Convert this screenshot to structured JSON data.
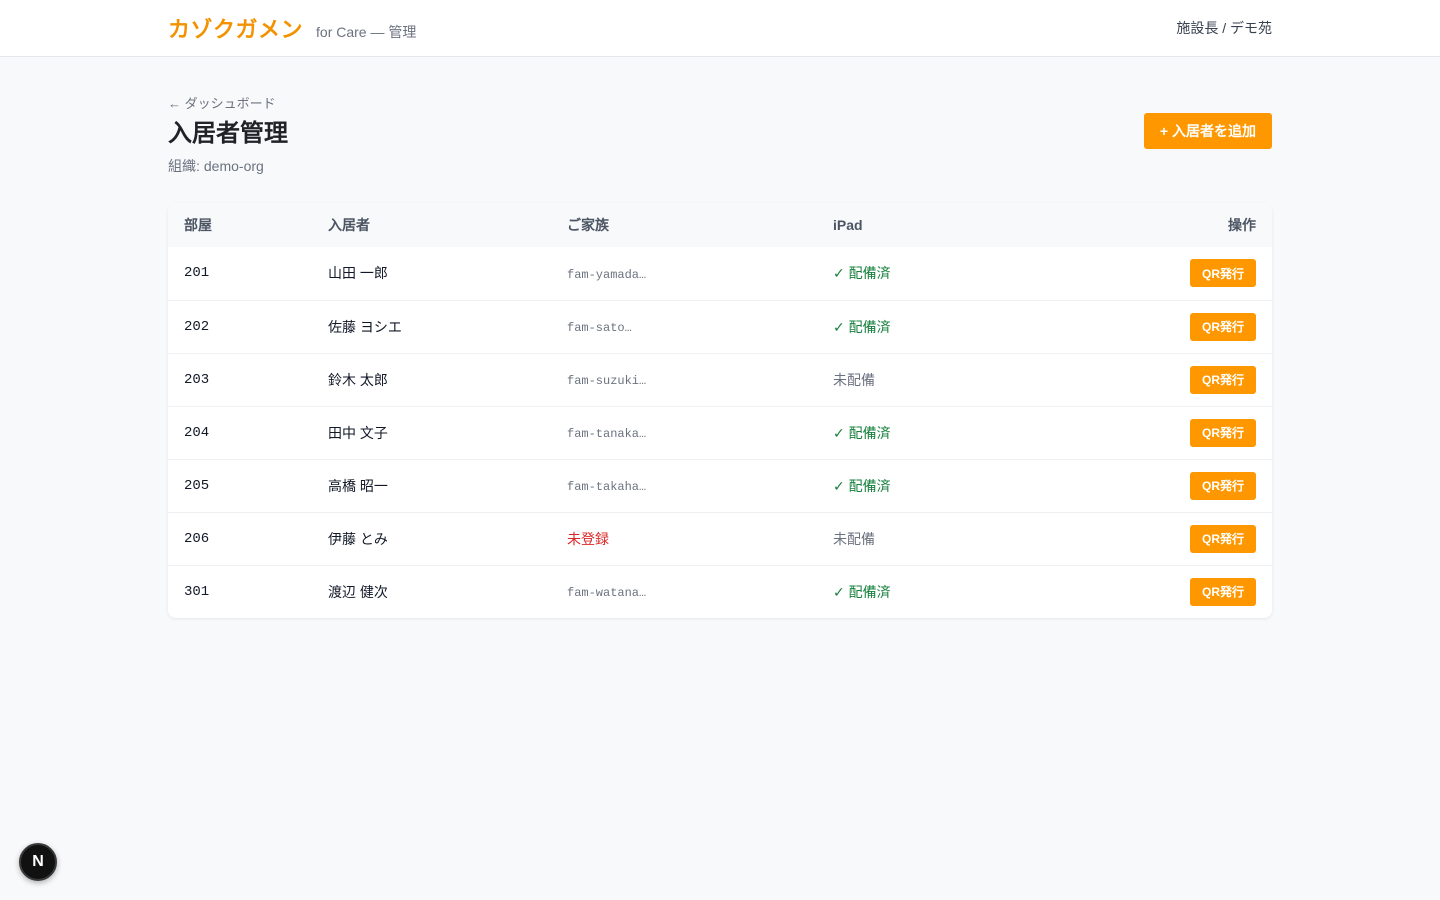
{
  "header": {
    "logo": "カゾクガメン",
    "subtitle": "for Care — 管理",
    "user": "施設長 / デモ苑"
  },
  "page": {
    "back_link": "← ダッシュボード",
    "title": "入居者管理",
    "org_label": "組織:",
    "org_value": "demo-org",
    "add_button": "+ 入居者を追加"
  },
  "table": {
    "headers": {
      "room": "部屋",
      "resident": "入居者",
      "family": "ご家族",
      "ipad": "iPad",
      "ops": "操作"
    },
    "action_label": "QR発行",
    "rows": [
      {
        "room": "201",
        "name": "山田 一郎",
        "family": "fam-yamada…",
        "ipad": "✓ 配備済"
      },
      {
        "room": "202",
        "name": "佐藤 ヨシエ",
        "family": "fam-sato…",
        "ipad": "✓ 配備済"
      },
      {
        "room": "203",
        "name": "鈴木 太郎",
        "family": "fam-suzuki…",
        "ipad": "未配備"
      },
      {
        "room": "204",
        "name": "田中 文子",
        "family": "fam-tanaka…",
        "ipad": "✓ 配備済"
      },
      {
        "room": "205",
        "name": "高橋 昭一",
        "family": "fam-takaha…",
        "ipad": "✓ 配備済"
      },
      {
        "room": "206",
        "name": "伊藤 とみ",
        "family": "未登録",
        "ipad": "未配備"
      },
      {
        "room": "301",
        "name": "渡辺 健次",
        "family": "fam-watana…",
        "ipad": "✓ 配備済"
      }
    ]
  },
  "badge": {
    "letter": "N"
  },
  "colors": {
    "accent": "#ff9800",
    "brand": "#f39200",
    "status_ok": "#15803d",
    "status_error": "#dc2626"
  }
}
